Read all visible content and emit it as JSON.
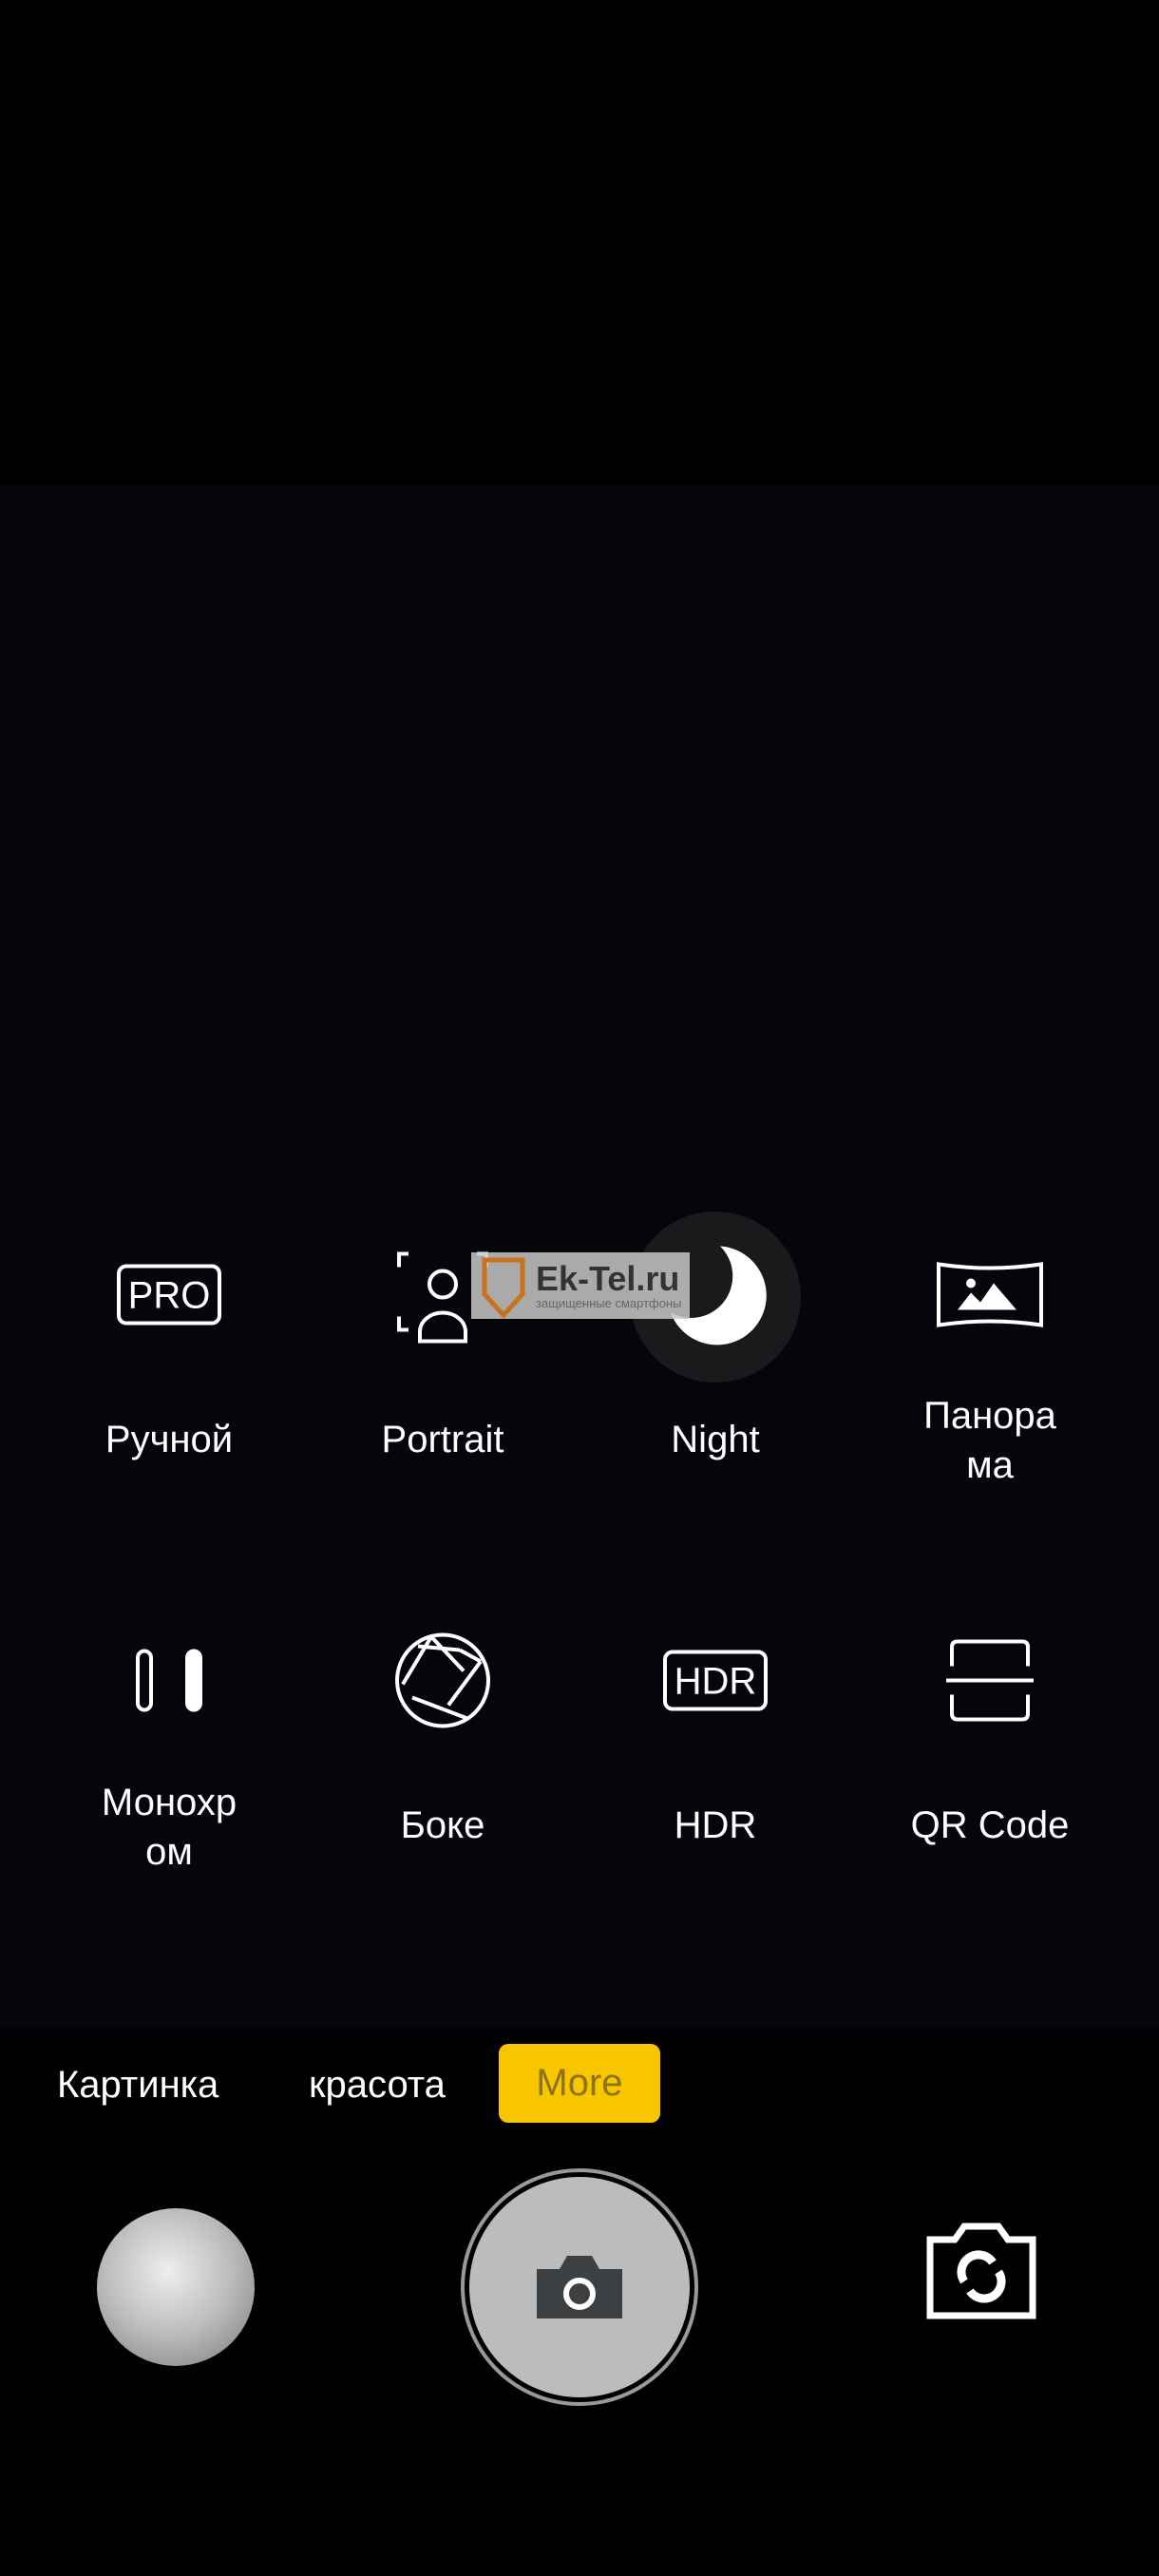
{
  "modes_grid": [
    {
      "label": "Ручной",
      "icon": "pro-icon"
    },
    {
      "label": "Portrait",
      "icon": "portrait-icon"
    },
    {
      "label": "Night",
      "icon": "moon-icon",
      "selected": true
    },
    {
      "label": "Панора\nма",
      "icon": "panorama-icon"
    },
    {
      "label": "Монохр\nом",
      "icon": "monochrome-icon"
    },
    {
      "label": "Боке",
      "icon": "aperture-icon"
    },
    {
      "label": "HDR",
      "icon": "hdr-icon"
    },
    {
      "label": "QR Code",
      "icon": "qr-scan-icon"
    }
  ],
  "icon_text": {
    "pro": "PRO",
    "hdr": "HDR"
  },
  "watermark": {
    "title": "Ek-Tel.ru",
    "subtitle": "защищенные смартфоны"
  },
  "mode_bar": {
    "tabs": [
      "Картинка",
      "красота"
    ],
    "active": "More",
    "active_color": "#f7c600"
  },
  "controls": {
    "gallery": "gallery-thumbnail",
    "shutter": "shutter-button",
    "switch": "switch-camera-button"
  }
}
